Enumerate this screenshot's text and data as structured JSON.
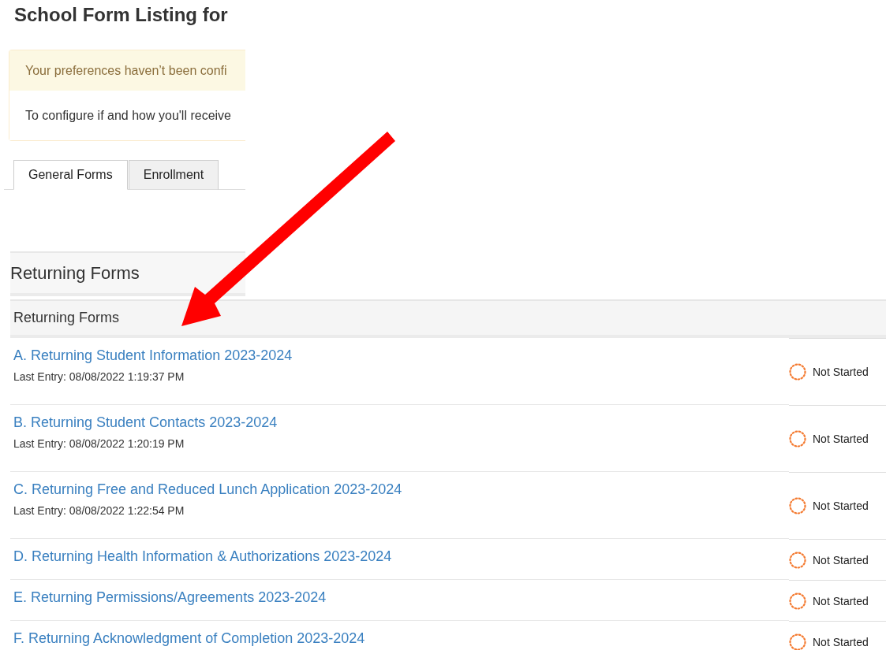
{
  "page_title": "School Form Listing for",
  "alert": {
    "heading": "Your preferences haven’t been confi",
    "body": "To configure if and how you'll receive"
  },
  "tabs": [
    {
      "label": "General Forms",
      "selected": true
    },
    {
      "label": "Enrollment",
      "selected": false
    }
  ],
  "section": {
    "title": "Returning Forms"
  },
  "table": {
    "header": "Returning Forms",
    "rows": [
      {
        "title": "A. Returning Student Information 2023-2024",
        "last_entry": "Last Entry: 08/08/2022 1:19:37 PM",
        "status": {
          "kind": "not_started",
          "label": "Not Started"
        }
      },
      {
        "title": "B. Returning Student Contacts 2023-2024",
        "last_entry": "Last Entry: 08/08/2022 1:20:19 PM",
        "status": {
          "kind": "not_started",
          "label": "Not Started"
        }
      },
      {
        "title": "C. Returning Free and Reduced Lunch Application 2023-2024",
        "last_entry": "Last Entry: 08/08/2022 1:22:54 PM",
        "status": {
          "kind": "not_started",
          "label": "Not Started"
        }
      },
      {
        "title": "D. Returning Health Information & Authorizations 2023-2024",
        "status": {
          "kind": "not_started",
          "label": "Not Started"
        }
      },
      {
        "title": "E. Returning Permissions/Agreements 2023-2024",
        "status": {
          "kind": "not_started",
          "label": "Not Started"
        }
      },
      {
        "title": "F. Returning Acknowledgment of Completion 2023-2024",
        "status": {
          "kind": "not_started",
          "label": "Not Started"
        }
      }
    ]
  }
}
